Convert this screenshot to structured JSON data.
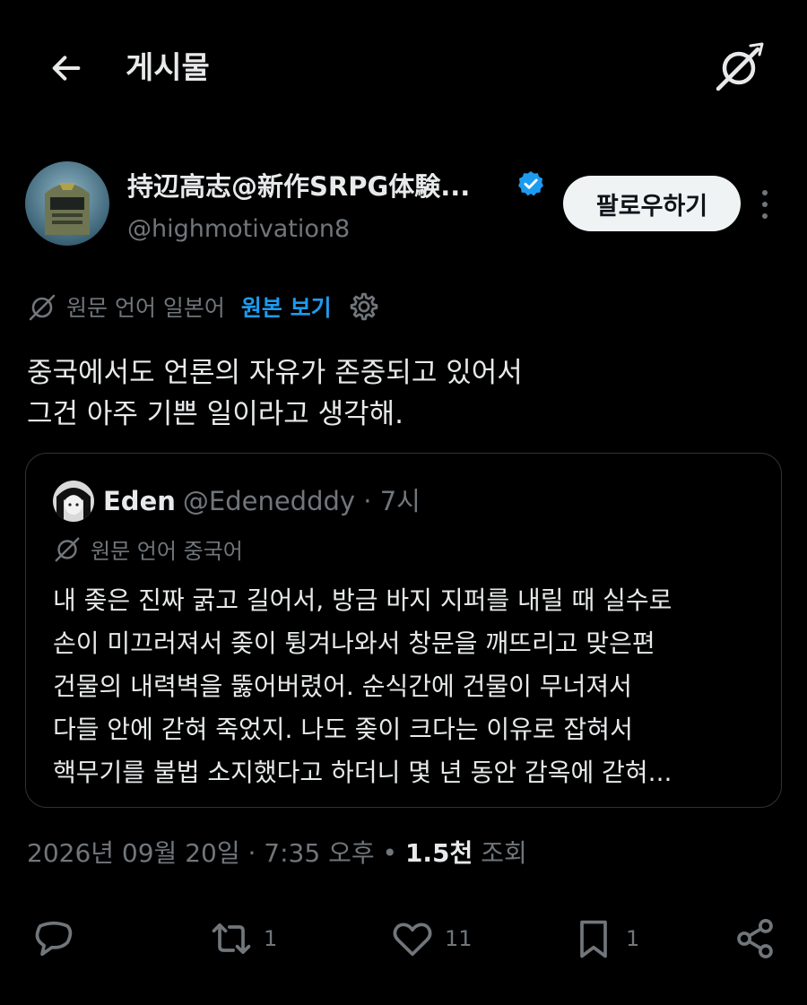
{
  "header": {
    "title": "게시물"
  },
  "author": {
    "name": "持辺高志@新作SRPG体験...",
    "handle": "@highmotivation8",
    "follow_label": "팔로우하기"
  },
  "translation": {
    "label": "원문 언어 일본어",
    "view_original": "원본 보기"
  },
  "tweet": {
    "lines": [
      "중국에서도 언론의 자유가 존중되고 있어서",
      "그건 아주 기쁜 일이라고 생각해."
    ]
  },
  "quote": {
    "name": "Eden",
    "handle": "@Edenedddy · 7시",
    "translation_label": "원문 언어 중국어",
    "lines": [
      "내 좆은 진짜 굵고 길어서, 방금 바지 지퍼를 내릴 때 실수로",
      "손이 미끄러져서 좆이 튕겨나와서 창문을 깨뜨리고 맞은편",
      "건물의 내력벽을 뚫어버렸어. 순식간에 건물이 무너져서",
      "다들 안에 갇혀 죽었지. 나도 좆이 크다는 이유로 잡혀서",
      "핵무기를 불법 소지했다고 하더니 몇 년 동안 감옥에 갇혀..."
    ]
  },
  "meta": {
    "timestamp": "2026년 09월 20일 · 7:35 오후",
    "separator": " • ",
    "views_count": "1.5천",
    "views_label": " 조회"
  },
  "actions": {
    "reply_count": "",
    "retweet_count": "1",
    "like_count": "11",
    "bookmark_count": "1"
  },
  "colors": {
    "background": "#000000",
    "text": "#e7e9ea",
    "muted": "#71767b",
    "accent": "#1d9bf0",
    "border": "#2f3336"
  },
  "icons": [
    "back-arrow-icon",
    "app-logo-icon",
    "verified-badge-icon",
    "more-icon",
    "translate-globe-icon",
    "settings-icon",
    "reply-icon",
    "retweet-icon",
    "like-icon",
    "bookmark-icon",
    "share-icon"
  ]
}
